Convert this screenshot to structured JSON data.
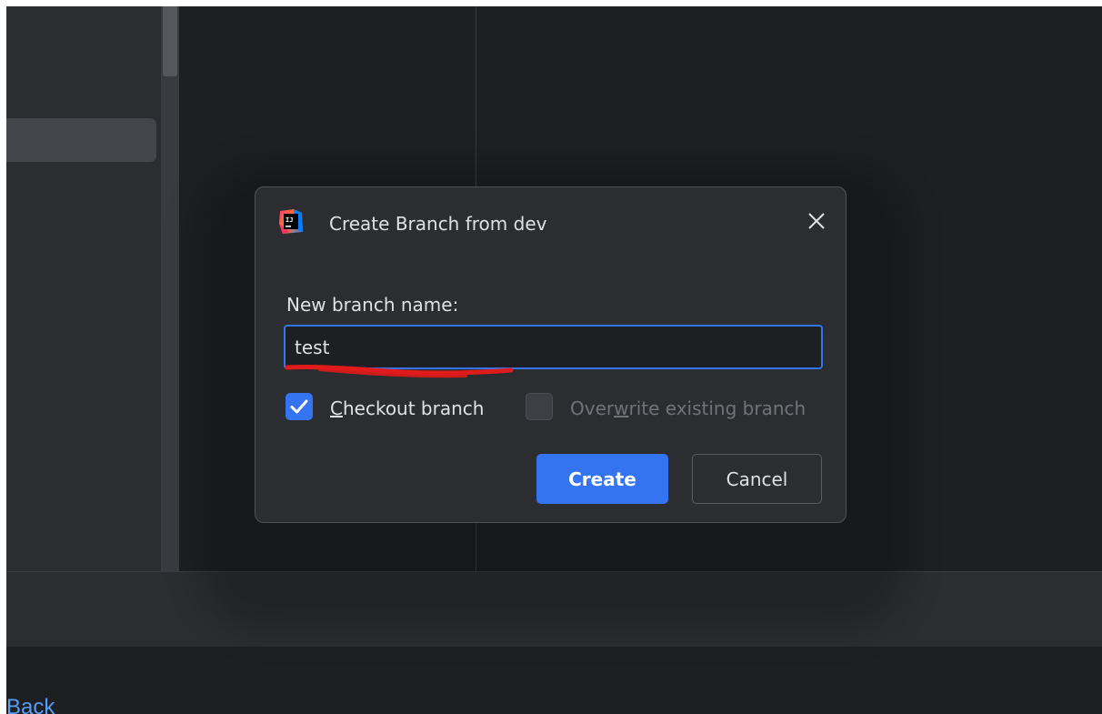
{
  "dialog": {
    "title": "Create Branch from dev",
    "app_icon": "intellij-idea-icon",
    "close_icon": "close-icon",
    "field_label": "New branch name:",
    "branch_name_value": "test",
    "checkout": {
      "pre": "",
      "mnemonic": "C",
      "post": "heckout branch",
      "checked": true
    },
    "overwrite": {
      "pre": "Over",
      "mnemonic": "w",
      "post": "rite existing branch",
      "checked": false,
      "disabled": true
    },
    "create_label": "Create",
    "cancel_label": "Cancel"
  },
  "footer": {
    "back_link": "Back"
  },
  "colors": {
    "accent": "#3574f0",
    "dialog_bg": "#2b2d30",
    "ide_bg": "#1e1f22",
    "annotation": "#e01b1b"
  }
}
